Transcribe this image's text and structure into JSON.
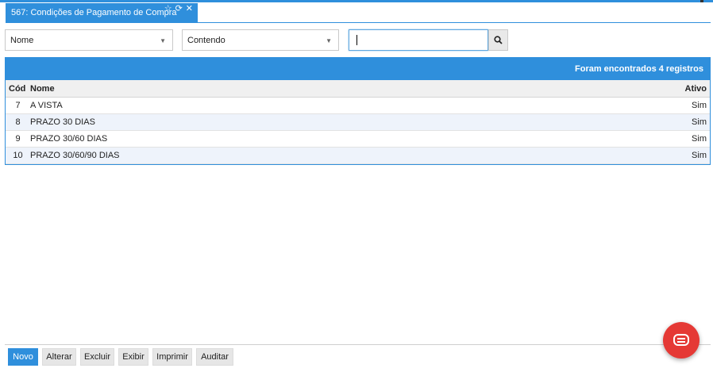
{
  "tab": {
    "title": "567: Condições de Pagamento de Compra",
    "icons": [
      "star-icon",
      "refresh-icon",
      "close-icon"
    ]
  },
  "filters": {
    "field_select": "Nome",
    "operator_select": "Contendo",
    "search_value": ""
  },
  "grid": {
    "header_text": "Foram encontrados 4 registros",
    "columns": {
      "cod": "Cód",
      "nome": "Nome",
      "ativo": "Ativo"
    },
    "rows": [
      {
        "cod": "7",
        "nome": "A VISTA",
        "ativo": "Sim"
      },
      {
        "cod": "8",
        "nome": "PRAZO 30 DIAS",
        "ativo": "Sim"
      },
      {
        "cod": "9",
        "nome": "PRAZO 30/60 DIAS",
        "ativo": "Sim"
      },
      {
        "cod": "10",
        "nome": "PRAZO 30/60/90 DIAS",
        "ativo": "Sim"
      }
    ]
  },
  "toolbar": {
    "novo": "Novo",
    "alterar": "Alterar",
    "excluir": "Excluir",
    "exibir": "Exibir",
    "imprimir": "Imprimir",
    "auditar": "Auditar"
  },
  "colors": {
    "accent": "#2f8fdc",
    "chat": "#e53935"
  }
}
